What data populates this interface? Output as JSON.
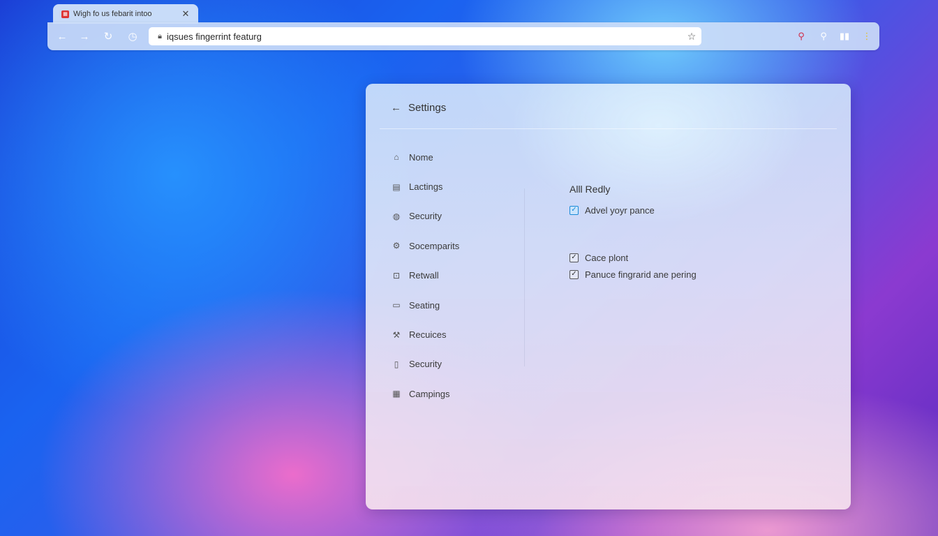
{
  "browser": {
    "tab_title": "Wigh fo us febarit intoo",
    "tab_favicon": "calendar-icon",
    "url": "iqsues fingerrint featurg",
    "toolbar_icons": [
      "back-icon",
      "forward-icon",
      "reload-icon",
      "history-icon",
      "search-red-icon",
      "search-icon",
      "bars-icon",
      "menu-dots-icon"
    ],
    "colors": {
      "search_red": "#d0304a",
      "menu_dots": "#e8c020"
    }
  },
  "settings": {
    "title": "Settings",
    "sidebar": [
      {
        "label": "Nome",
        "icon": "tag-icon"
      },
      {
        "label": "Lactings",
        "icon": "clipboard-icon"
      },
      {
        "label": "Security",
        "icon": "globe-icon"
      },
      {
        "label": "Socemparits",
        "icon": "gear-icon"
      },
      {
        "label": "Retwall",
        "icon": "lock-icon"
      },
      {
        "label": "Seating",
        "icon": "monitor-icon"
      },
      {
        "label": "Recuices",
        "icon": "wrench-icon"
      },
      {
        "label": "Security",
        "icon": "document-icon"
      },
      {
        "label": "Campings",
        "icon": "calendar-icon"
      }
    ],
    "section_title": "Alll Redly",
    "checkboxes": [
      {
        "label": "Advel yoyr pance",
        "checked": true,
        "accent": "#1a8ad8"
      },
      {
        "label": "Cace plont",
        "checked": true
      },
      {
        "label": "Panuce fingrarid ane pering",
        "checked": true
      }
    ]
  }
}
